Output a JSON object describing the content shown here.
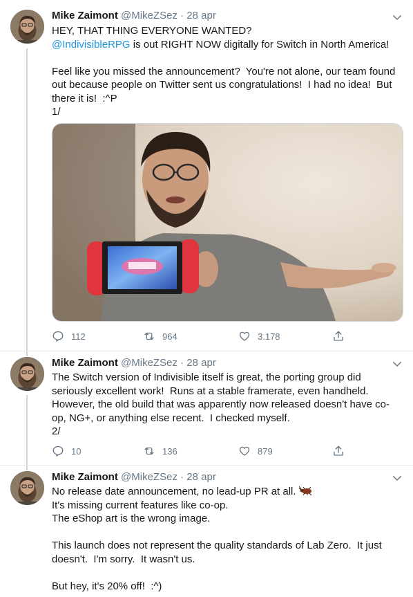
{
  "tweets": [
    {
      "author": {
        "name": "Mike Zaimont",
        "handle": "@MikeZSez",
        "separator": "·",
        "date": "28 apr"
      },
      "lines": [
        {
          "text": "HEY, THAT THING EVERYONE WANTED?"
        },
        {
          "mention": "@IndivisibleRPG",
          "text": " is out RIGHT NOW digitally for Switch in North America!"
        },
        {
          "text": ""
        },
        {
          "text": "Feel like you missed the announcement?  You're not alone, our team found"
        },
        {
          "text": "out because people on Twitter sent us congratulations!  I had no idea!  But"
        },
        {
          "text": "there it is!  :^P"
        },
        {
          "text": "1/"
        }
      ],
      "media": {
        "type": "photo",
        "subject": "man holding Nintendo Switch showing Indivisible"
      },
      "stats": {
        "replies": "112",
        "retweets": "964",
        "likes": "3.178"
      }
    },
    {
      "author": {
        "name": "Mike Zaimont",
        "handle": "@MikeZSez",
        "separator": "·",
        "date": "28 apr"
      },
      "lines": [
        {
          "text": "The Switch version of Indivisible itself is great, the porting group did"
        },
        {
          "text": "seriously excellent work!  Runs at a stable framerate, even handheld."
        },
        {
          "text": "However, the old build that was apparently now released doesn't have co-"
        },
        {
          "text": "op, NG+, or anything else recent.  I checked myself."
        },
        {
          "text": "2/"
        }
      ],
      "stats": {
        "replies": "10",
        "retweets": "136",
        "likes": "879"
      }
    },
    {
      "author": {
        "name": "Mike Zaimont",
        "handle": "@MikeZSez",
        "separator": "·",
        "date": "28 apr"
      },
      "lines": [
        {
          "text": "No release date announcement, no lead-up PR at all. ",
          "emoji": "cockroach-emoji"
        },
        {
          "text": "It's missing current features like co-op."
        },
        {
          "text": "The eShop art is the wrong image."
        },
        {
          "text": ""
        },
        {
          "text": "This launch does not represent the quality standards of Lab Zero.  It just"
        },
        {
          "text": "doesn't.  I'm sorry.  It wasn't us."
        },
        {
          "text": ""
        },
        {
          "text": "But hey, it's 20% off!  :^)"
        }
      ]
    }
  ],
  "icons": {
    "reply": "reply-icon",
    "retweet": "retweet-icon",
    "like": "heart-icon",
    "share": "share-icon",
    "menu": "chevron-down-icon"
  },
  "colors": {
    "text": "#14171a",
    "secondary": "#657786",
    "link": "#1b95e0",
    "thread_line": "#ccd6dd",
    "divider": "#e6ecf0"
  }
}
